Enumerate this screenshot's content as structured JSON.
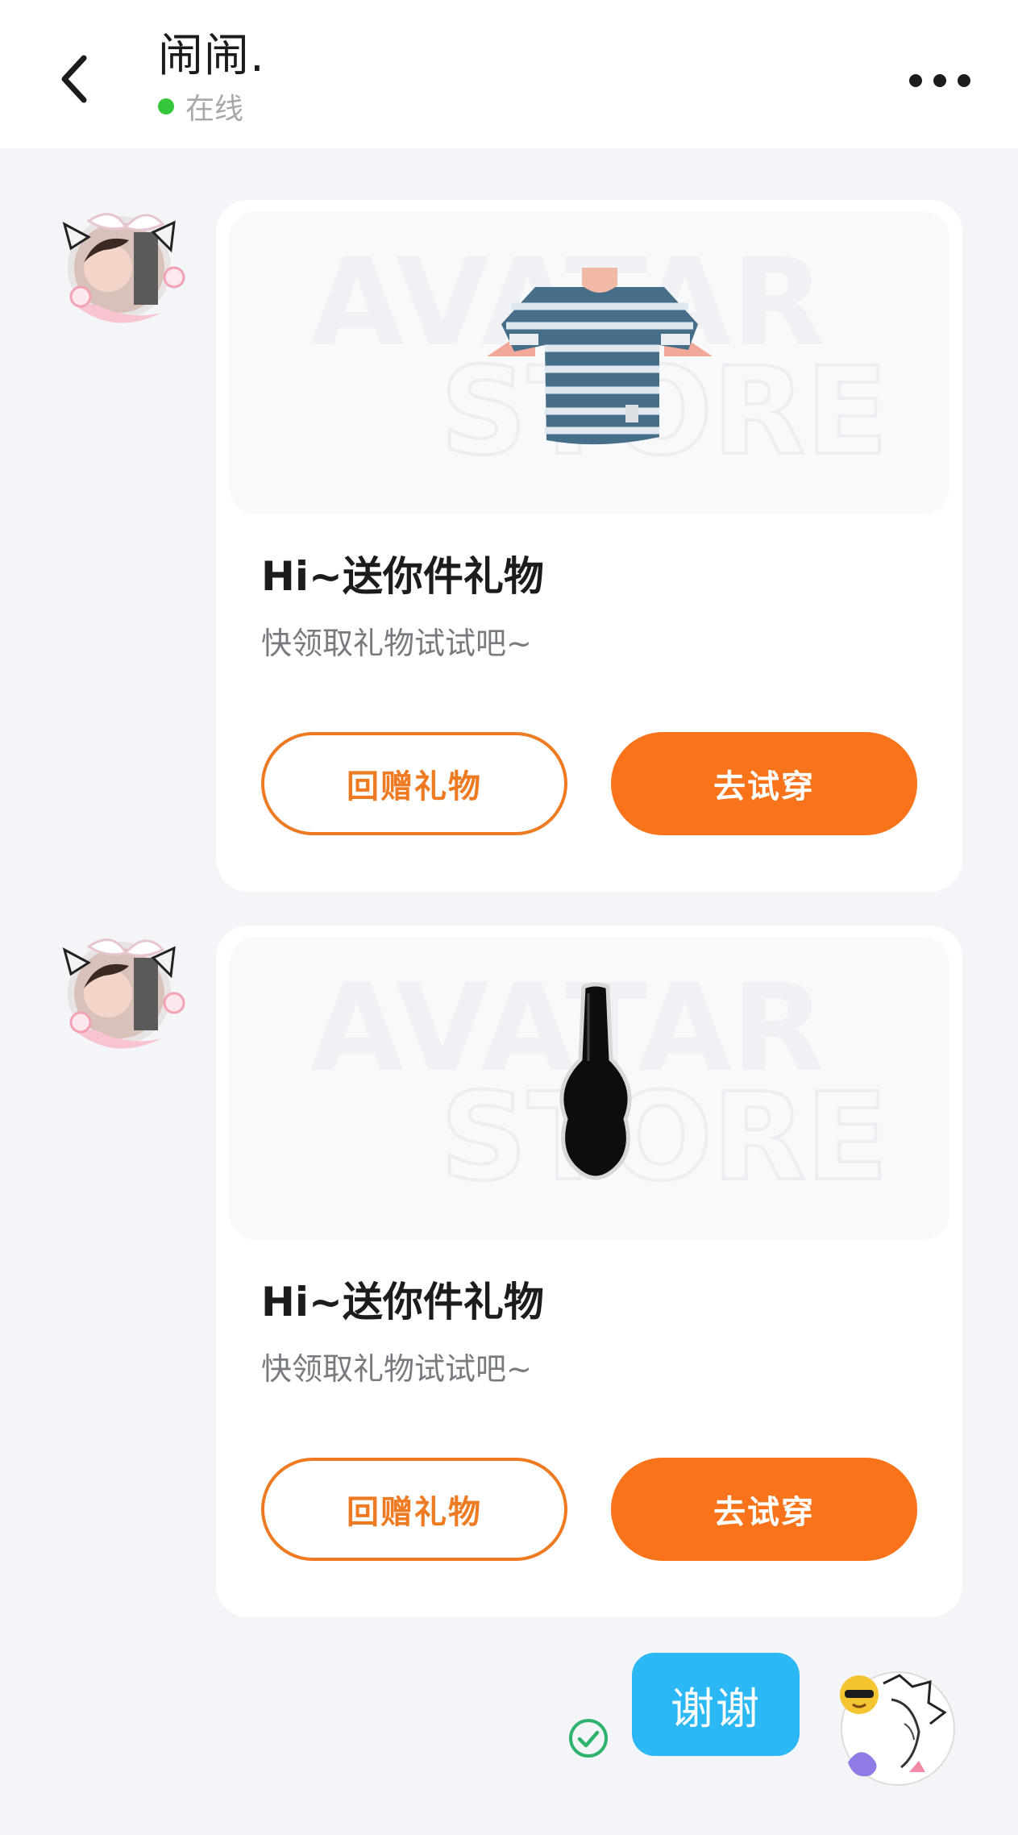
{
  "header": {
    "title": "闹闹.",
    "status": "在线",
    "status_color": "#36c63a",
    "back_icon": "chevron-left-icon",
    "more_icon": "more-horizontal-icon"
  },
  "gift_cards": [
    {
      "item": "striped-tshirt",
      "watermark_line1": "AVATAR",
      "watermark_line2": "STORE",
      "title": "Hi~送你件礼物",
      "subtitle": "快领取礼物试试吧~",
      "return_gift_label": "回赠礼物",
      "try_on_label": "去试穿"
    },
    {
      "item": "guitar-case",
      "watermark_line1": "AVATAR",
      "watermark_line2": "STORE",
      "title": "Hi~送你件礼物",
      "subtitle": "快领取礼物试试吧~",
      "return_gift_label": "回赠礼物",
      "try_on_label": "去试穿"
    }
  ],
  "my_message": {
    "text": "谢谢",
    "status_icon": "sent-check-icon"
  },
  "colors": {
    "accent_orange": "#f8731a",
    "bubble_blue": "#2cb8f5",
    "background": "#f3f5f9"
  }
}
